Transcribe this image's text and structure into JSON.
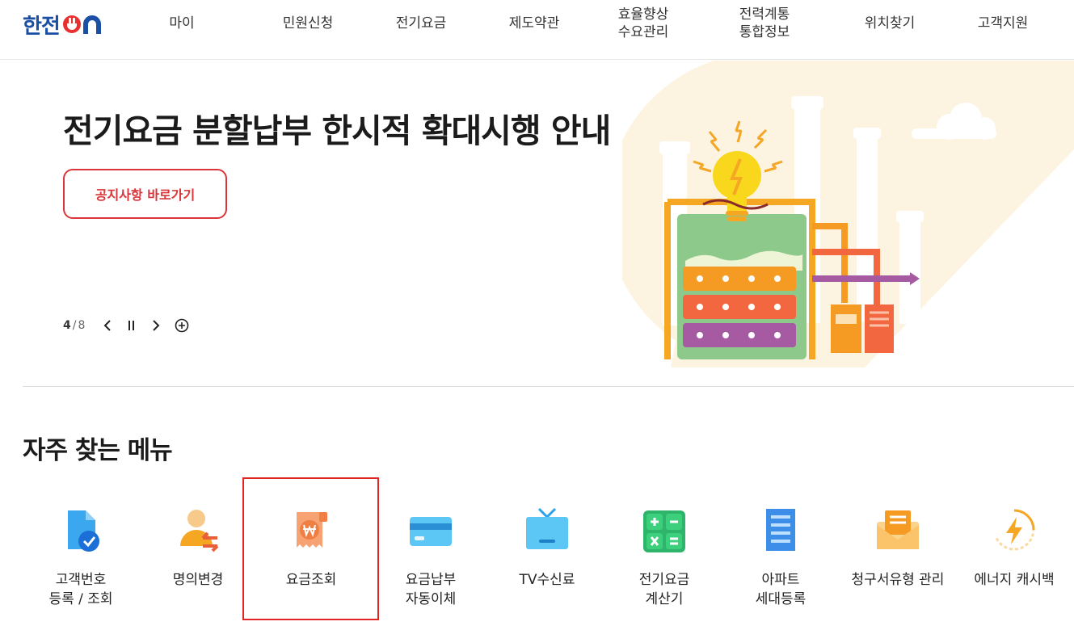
{
  "header": {
    "logo": {
      "brand": "한전",
      "suffix": "ON"
    },
    "nav": [
      {
        "label": "마이"
      },
      {
        "label": "민원신청"
      },
      {
        "label": "전기요금"
      },
      {
        "label": "제도약관"
      },
      {
        "label": "효율향상\n수요관리"
      },
      {
        "label": "전력계통\n통합정보"
      },
      {
        "label": "위치찾기"
      },
      {
        "label": "고객지원"
      }
    ]
  },
  "banner": {
    "title": "전기요금 분할납부 한시적 확대시행 안내",
    "button_label": "공지사항 바로가기",
    "pager": {
      "current": "4",
      "separator": "/",
      "total": "8"
    },
    "colors": {
      "accent_red": "#d9353a",
      "bg_peach": "#fdf3e1"
    }
  },
  "quick_menu": {
    "title": "자주 찾는 메뉴",
    "items": [
      {
        "label": "고객번호\n등록 / 조회",
        "icon": "document-check-icon"
      },
      {
        "label": "명의변경",
        "icon": "person-transfer-icon"
      },
      {
        "label": "요금조회",
        "icon": "won-receipt-icon"
      },
      {
        "label": "요금납부\n자동이체",
        "icon": "credit-card-icon"
      },
      {
        "label": "TV수신료",
        "icon": "tv-icon"
      },
      {
        "label": "전기요금\n계산기",
        "icon": "calculator-icon"
      },
      {
        "label": "아파트\n세대등록",
        "icon": "apartment-icon"
      },
      {
        "label": "청구서유형 관리",
        "icon": "envelope-icon"
      },
      {
        "label": "에너지 캐시백",
        "icon": "energy-cashback-icon"
      }
    ]
  }
}
